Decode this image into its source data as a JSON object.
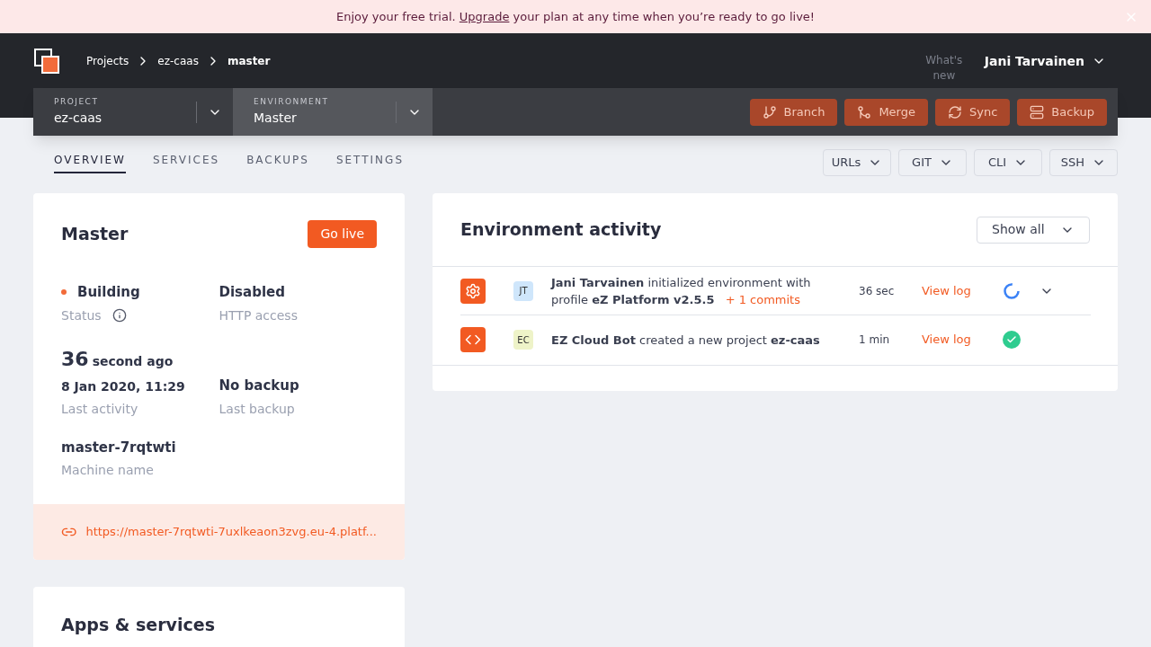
{
  "banner": {
    "before": "Enjoy your free trial.",
    "link": "Upgrade",
    "after": "your plan at any time when you’re ready to go live!"
  },
  "breadcrumbs": [
    "Projects",
    "ez-caas",
    "master"
  ],
  "whats_new": "What's new",
  "user": "Jani Tarvainen",
  "selectors": [
    {
      "label": "PROJECT",
      "value": "ez-caas",
      "selected": false
    },
    {
      "label": "ENVIRONMENT",
      "value": "Master",
      "selected": true
    }
  ],
  "actions": [
    {
      "label": "Branch",
      "kind": "branch"
    },
    {
      "label": "Merge",
      "kind": "merge"
    },
    {
      "label": "Sync",
      "kind": "sync"
    },
    {
      "label": "Backup",
      "kind": "backup"
    }
  ],
  "tabs": [
    {
      "label": "OVERVIEW",
      "selected": true
    },
    {
      "label": "SERVICES",
      "selected": false
    },
    {
      "label": "BACKUPS",
      "selected": false
    },
    {
      "label": "SETTINGS",
      "selected": false
    }
  ],
  "menus": [
    "URLs",
    "GIT",
    "CLI",
    "SSH"
  ],
  "environment": {
    "title": "Master",
    "go_live": "Go live",
    "status": {
      "value": "Building",
      "label": "Status",
      "color": "#f26b3a"
    },
    "http": {
      "value": "Disabled",
      "label": "HTTP access"
    },
    "activity": {
      "number": "36",
      "unit": "second ago",
      "date": "8 Jan 2020, 11:29",
      "label": "Last activity"
    },
    "backup": {
      "value": "No backup",
      "label": "Last backup"
    },
    "machine": {
      "value": "master-7rqtwti",
      "label": "Machine name"
    },
    "url": "https://master-7rqtwti-7uxlkeaon3zvg.eu-4.platf..."
  },
  "apps_title": "Apps & services",
  "activity_panel": {
    "title": "Environment activity",
    "filter": "Show all",
    "rows": [
      {
        "kind": "settings",
        "initials": "JT",
        "color": "#cfe6fb",
        "text": "**Jani Tarvainen** initialized environment with profile **eZ Platform v2.5.5**",
        "commits": "+ 1 commits",
        "time": "36 sec",
        "link": "View log",
        "done": false,
        "expandable": true
      },
      {
        "kind": "code",
        "initials": "EC",
        "color": "#eef3c8",
        "text": "**EZ Cloud Bot** created a new project **ez-caas**",
        "time": "1 min",
        "link": "View log",
        "done": true,
        "expandable": false
      }
    ]
  }
}
